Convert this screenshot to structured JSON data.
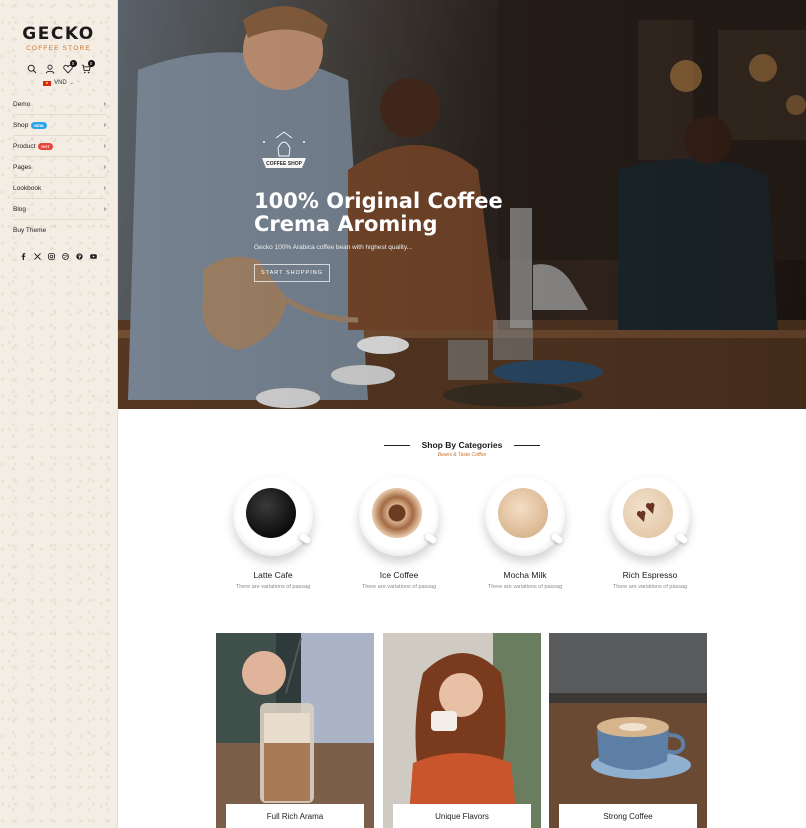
{
  "brand": {
    "name": "GECKO",
    "tagline": "COFFEE STORE"
  },
  "header": {
    "wishlist_count": "0",
    "cart_count": "0",
    "currency": "VND"
  },
  "menu": [
    {
      "label": "Demo",
      "tag": ""
    },
    {
      "label": "Shop",
      "tag": "NEW"
    },
    {
      "label": "Product",
      "tag": "HOT"
    },
    {
      "label": "Pages",
      "tag": ""
    },
    {
      "label": "Lookbook",
      "tag": ""
    },
    {
      "label": "Blog",
      "tag": ""
    },
    {
      "label": "Buy Theme",
      "tag": ""
    }
  ],
  "social": [
    "facebook-icon",
    "x-icon",
    "instagram-icon",
    "dribbble-icon",
    "pinterest-icon",
    "youtube-icon"
  ],
  "hero": {
    "badge_text": "COFFEE SHOP",
    "title_line1": "100% Original Coffee",
    "title_line2": "Crema Aroming",
    "subtitle": "Gecko 100% Arabica coffee bean with highest quality...",
    "button": "START SHOPPING"
  },
  "categories_section": {
    "title": "Shop By Categories",
    "subtitle": "Beans & Taste Coffee",
    "items": [
      {
        "name": "Latte Cafe",
        "desc": "There are variations of passag"
      },
      {
        "name": "Ice Coffee",
        "desc": "There are variations of passag"
      },
      {
        "name": "Mocha Milk",
        "desc": "There are variations of passag"
      },
      {
        "name": "Rich Espresso",
        "desc": "There are variations of passag"
      }
    ]
  },
  "products": [
    {
      "label": "Full Rich Arama"
    },
    {
      "label": "Unique Flavors"
    },
    {
      "label": "Strong Coffee"
    }
  ],
  "colors": {
    "accent": "#c8742f",
    "sidebar_bg": "#f3ede4",
    "tag_new": "#2ea3e8",
    "tag_hot": "#e8443a"
  }
}
